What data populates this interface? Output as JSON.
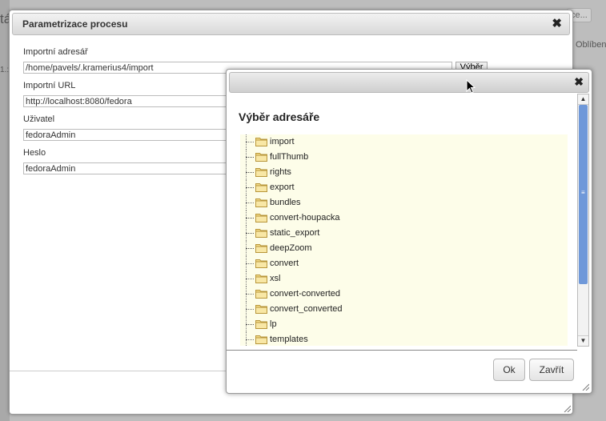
{
  "background": {
    "fragment_left": "tá",
    "fragment_left2": "1.:",
    "fragment_top_right": "ce...",
    "fragment_right": "Oblíben"
  },
  "main_dialog": {
    "title": "Parametrizace procesu",
    "close_glyph": "✖",
    "fields": [
      {
        "label": "Importní adresář",
        "value": "/home/pavels/.kramerius4/import"
      },
      {
        "label": "Importní URL",
        "value": "http://localhost:8080/fedora"
      },
      {
        "label": "Uživatel",
        "value": "fedoraAdmin"
      },
      {
        "label": "Heslo",
        "value": "fedoraAdmin"
      }
    ],
    "browse_label": "Výběr"
  },
  "dir_dialog": {
    "close_glyph": "✖",
    "heading": "Výběr adresáře",
    "folders": [
      {
        "name": "import",
        "expandable": false
      },
      {
        "name": "fullThumb",
        "expandable": true
      },
      {
        "name": "rights",
        "expandable": true
      },
      {
        "name": "export",
        "expandable": true
      },
      {
        "name": "bundles",
        "expandable": false
      },
      {
        "name": "convert-houpacka",
        "expandable": true
      },
      {
        "name": "static_export",
        "expandable": true
      },
      {
        "name": "deepZoom",
        "expandable": true
      },
      {
        "name": "convert",
        "expandable": false
      },
      {
        "name": "xsl",
        "expandable": false
      },
      {
        "name": "convert-converted",
        "expandable": false
      },
      {
        "name": "convert_converted",
        "expandable": false
      },
      {
        "name": "lp",
        "expandable": true
      },
      {
        "name": "templates",
        "expandable": false
      }
    ],
    "ok_label": "Ok",
    "close_label": "Zavřít"
  },
  "colors": {
    "tree_background": "#fdfde9",
    "scroll_thumb": "#6f98d9"
  }
}
